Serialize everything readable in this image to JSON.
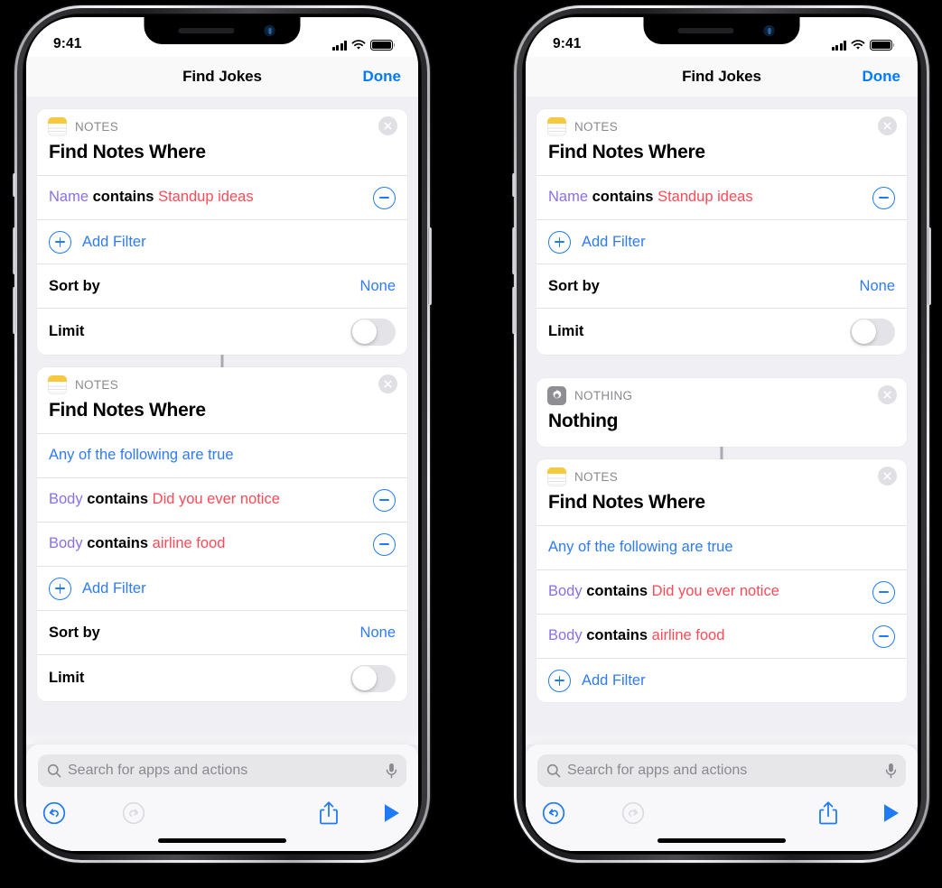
{
  "status_bar": {
    "time": "9:41",
    "signal_icon": "cellular-bars-icon",
    "wifi_icon": "wifi-icon",
    "battery_icon": "battery-full-icon"
  },
  "nav": {
    "title": "Find Jokes",
    "done_label": "Done"
  },
  "search": {
    "placeholder": "Search for apps and actions",
    "search_icon": "search-icon",
    "mic_icon": "microphone-icon"
  },
  "toolbar": {
    "undo_icon": "undo-icon",
    "redo_icon": "redo-icon",
    "share_icon": "share-icon",
    "play_icon": "play-icon"
  },
  "labels": {
    "app_notes": "NOTES",
    "app_nothing": "NOTHING",
    "find_notes_where": "Find Notes Where",
    "nothing_title": "Nothing",
    "add_filter": "Add Filter",
    "sort_by": "Sort by",
    "sort_value": "None",
    "limit": "Limit",
    "any_true": "Any of the following are true",
    "contains": "contains",
    "name_field": "Name",
    "body_field": "Body",
    "value_standup": "Standup ideas",
    "value_didyou": "Did you ever notice",
    "value_airline": "airline food"
  },
  "colors": {
    "accent_blue": "#007aff",
    "link_blue": "#2f7bf6",
    "value_red": "#ff4a56",
    "field_purple": "#8a6fe8",
    "notes_yellow": "#f6c93f",
    "nothing_gray": "#8e8e93",
    "screen_bg": "#efeff4"
  },
  "phones": [
    {
      "id": "left",
      "caption_state": "before"
    },
    {
      "id": "right",
      "caption_state": "after"
    }
  ]
}
